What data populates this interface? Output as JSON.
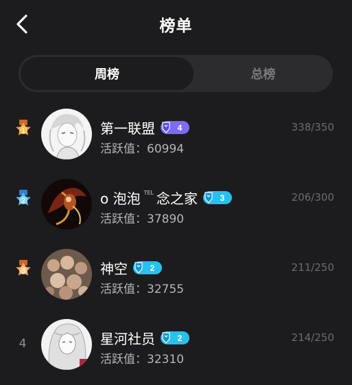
{
  "header": {
    "title": "榜单",
    "back_icon": "chevron-left-icon"
  },
  "tabs": [
    {
      "label": "周榜",
      "active": true
    },
    {
      "label": "总榜",
      "active": false
    }
  ],
  "colors": {
    "background": "#1c1c1e",
    "tab_track": "#2c2c2e",
    "gold": "#f0a335",
    "silver_blue": "#54b6f5",
    "bronze": "#f5a35a",
    "badge_purple": "#7b6cf6",
    "badge_cyan": "#27c1f0"
  },
  "ranking": [
    {
      "rank": "1",
      "medal": "gold-medal-icon",
      "name": "第一联盟",
      "tel": "",
      "name_suffix": "",
      "level": "4",
      "activity": "活跃值：60994",
      "progress": "338/350"
    },
    {
      "rank": "2",
      "medal": "silver-medal-icon",
      "name": "o 泡泡",
      "tel": "TEL",
      "name_suffix": "念之家",
      "level": "3",
      "activity": "活跃值：37890",
      "progress": "206/300"
    },
    {
      "rank": "3",
      "medal": "bronze-medal-icon",
      "name": "神空",
      "tel": "",
      "name_suffix": "",
      "level": "2",
      "activity": "活跃值：32755",
      "progress": "211/250"
    },
    {
      "rank": "4",
      "medal": "",
      "name": "星河社员",
      "tel": "",
      "name_suffix": "",
      "level": "2",
      "activity": "活跃值：32310",
      "progress": "214/250"
    }
  ]
}
